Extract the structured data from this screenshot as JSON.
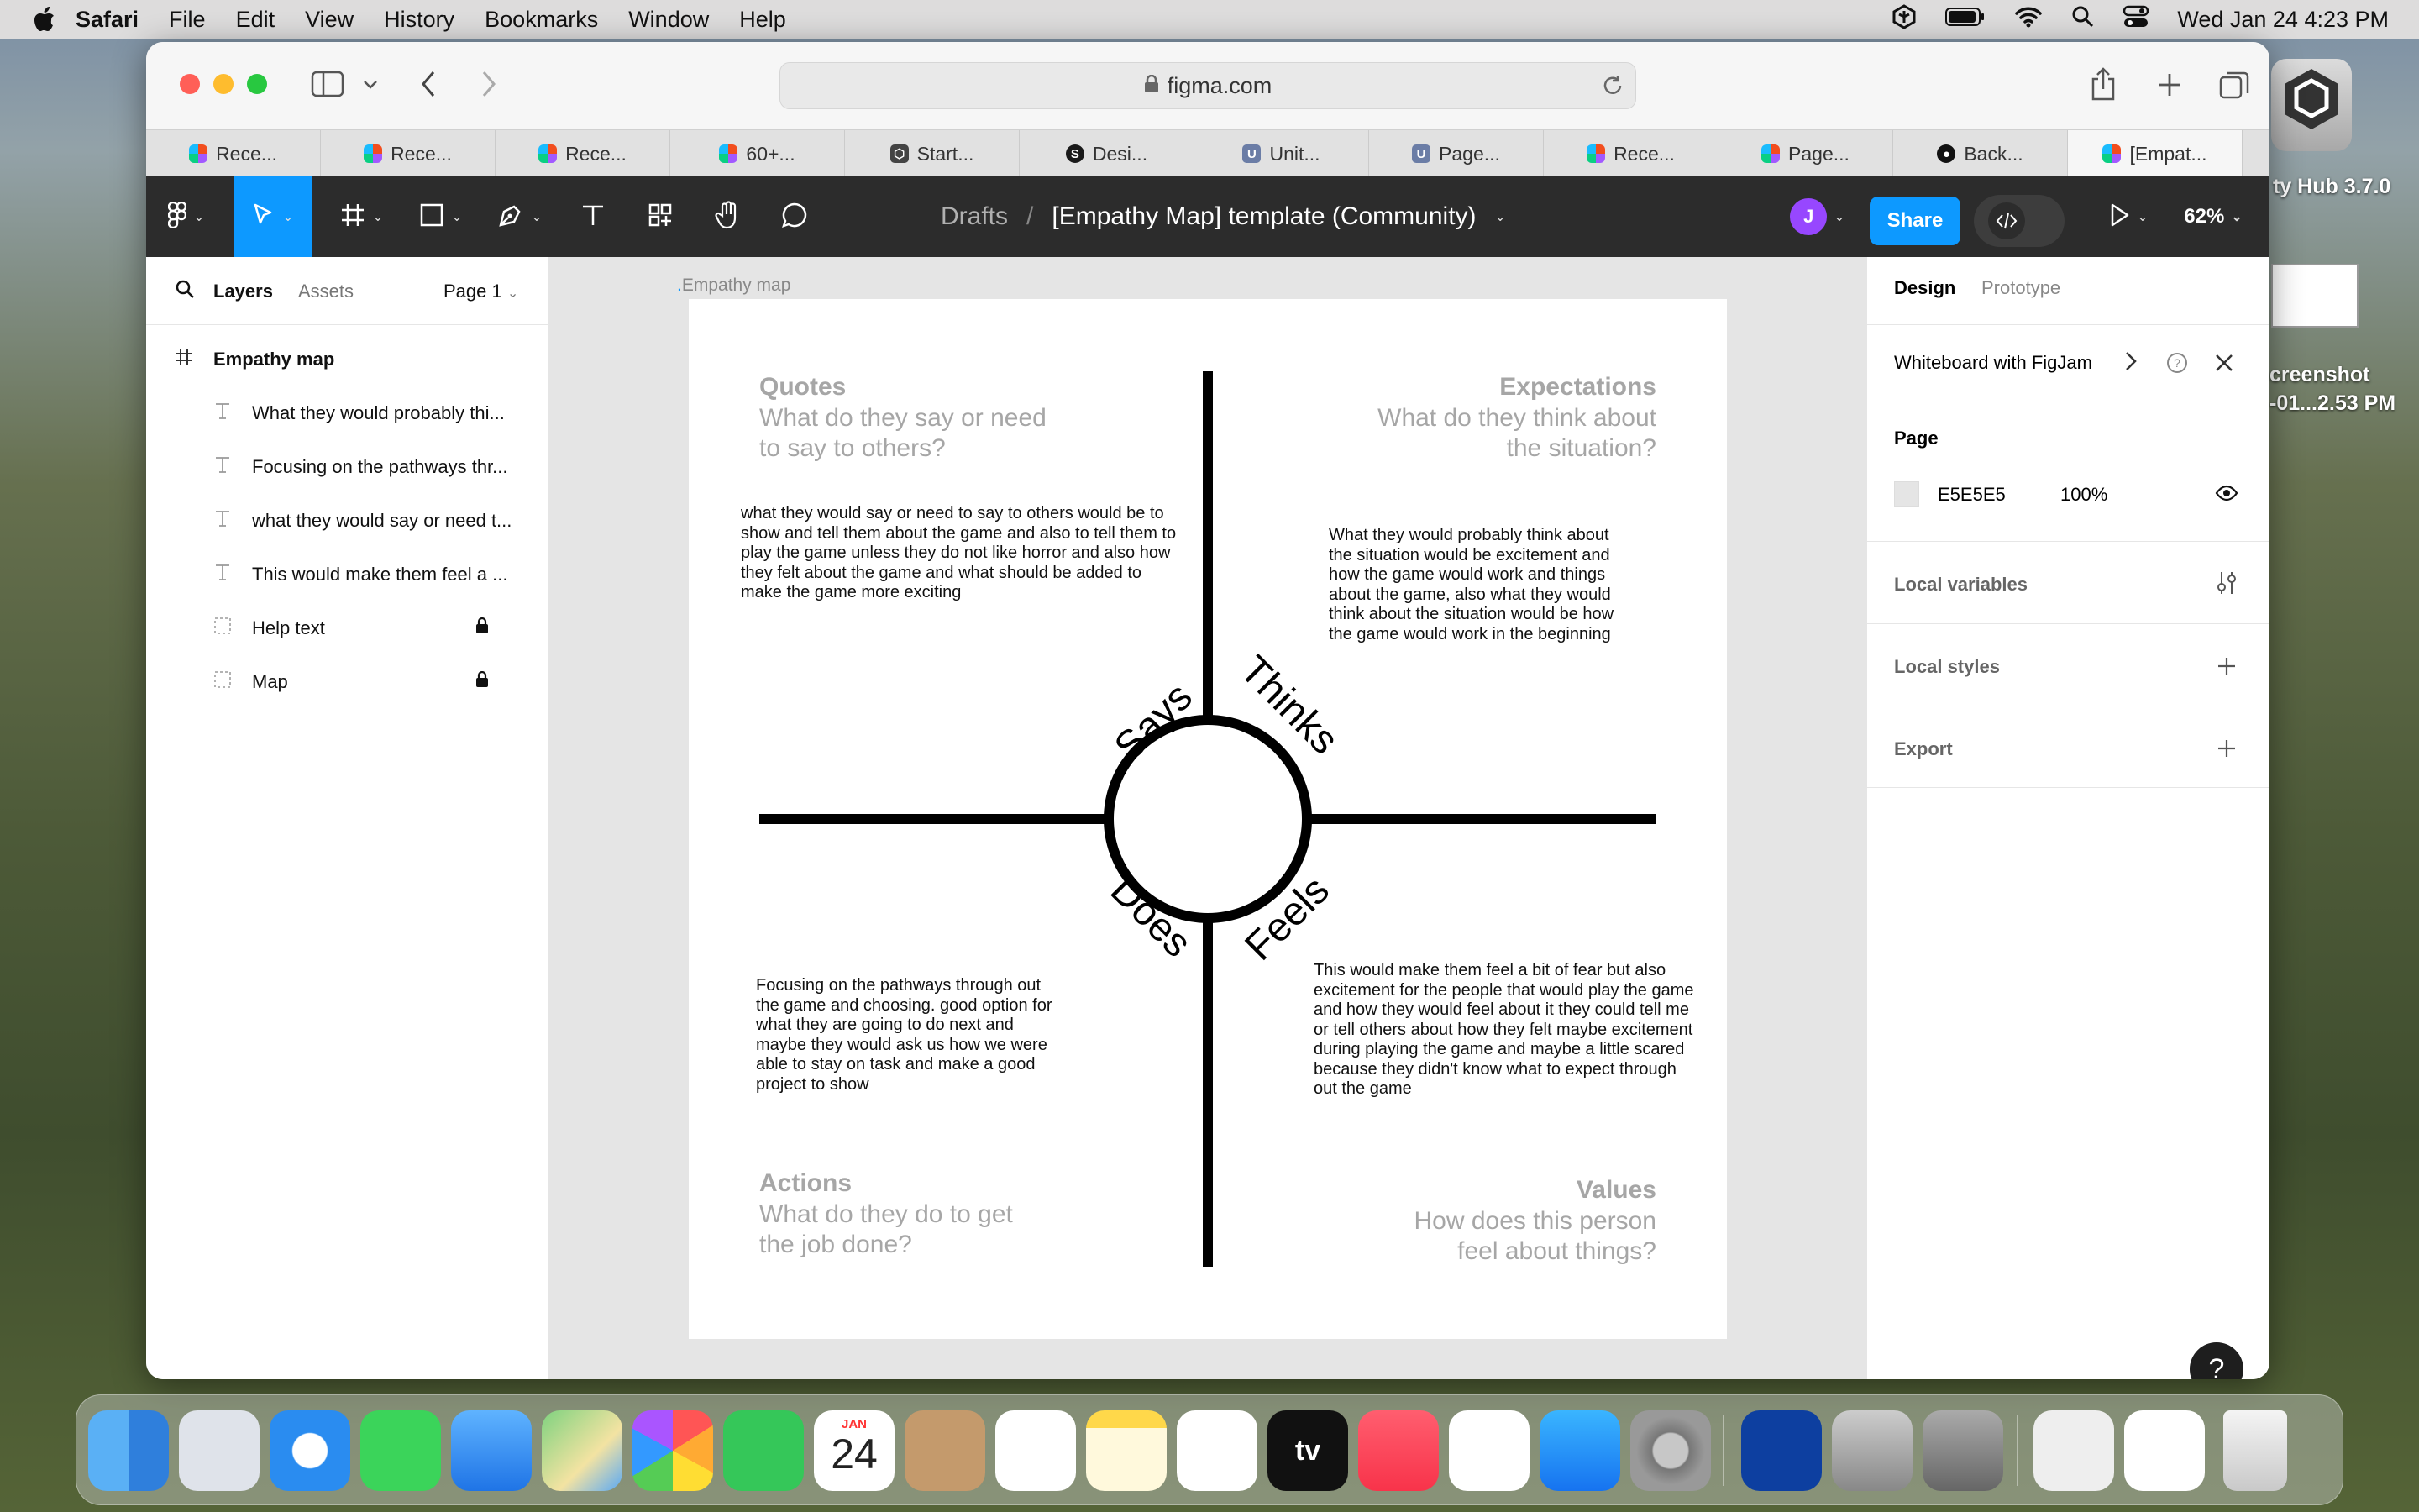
{
  "menubar": {
    "app": "Safari",
    "items": [
      "File",
      "Edit",
      "View",
      "History",
      "Bookmarks",
      "Window",
      "Help"
    ],
    "datetime": "Wed Jan 24  4:23 PM"
  },
  "browser": {
    "url": "figma.com",
    "tabs": [
      {
        "label": "Rece...",
        "icon": "figma-icon"
      },
      {
        "label": "Rece...",
        "icon": "figma-icon"
      },
      {
        "label": "Rece...",
        "icon": "figma-icon"
      },
      {
        "label": "60+...",
        "icon": "figma-icon"
      },
      {
        "label": "Start...",
        "icon": "unity-icon"
      },
      {
        "label": "Desi...",
        "icon": "s-icon"
      },
      {
        "label": "Unit...",
        "icon": "u-icon"
      },
      {
        "label": "Page...",
        "icon": "u-icon"
      },
      {
        "label": "Rece...",
        "icon": "figma-icon"
      },
      {
        "label": "Page...",
        "icon": "figma-icon"
      },
      {
        "label": "Back...",
        "icon": "github-icon"
      },
      {
        "label": "[Empat...",
        "icon": "figma-icon"
      }
    ]
  },
  "figma": {
    "breadcrumb_drafts": "Drafts",
    "file_title": "[Empathy Map] template (Community)",
    "avatar_letter": "J",
    "share_label": "Share",
    "zoom": "62%"
  },
  "left_panel": {
    "tab_layers": "Layers",
    "tab_assets": "Assets",
    "page_selector": "Page 1",
    "frame_name": "Empathy map",
    "layers": [
      "What they would probably thi...",
      "Focusing on the pathways thr...",
      "what they would say or need t...",
      "This would make them feel a ...",
      "Help text",
      "Map"
    ]
  },
  "canvas": {
    "frame_label": "Empathy map",
    "quotes_title": "Quotes",
    "quotes_sub": "What do they say or need to say to others?",
    "expectations_title": "Expectations",
    "expectations_sub": "What do they think about the situation?",
    "actions_title": "Actions",
    "actions_sub": "What do they do to get the job done?",
    "values_title": "Values",
    "values_sub": "How does this person feel about things?",
    "says": "Says",
    "thinks": "Thinks",
    "does": "Does",
    "feels": "Feels",
    "note_says": "what they would say or need to say to others would be to show and tell them about the game and also to tell them to play the game unless they do not like horror and also how they felt about the game and what should be added to make the game more exciting",
    "note_thinks": "What they would probably think about the situation would be excitement and how the game would work and things about the game, also what they would think about the situation would be how the game would work in the beginning",
    "note_does": "Focusing on the pathways through out the game and choosing. good option for what they are going to do next and maybe they would ask us how we were able to stay on task and make a good project to show",
    "note_feels": "This would make them feel a bit of fear but also excitement for the people that would play the game and how they would feel about it they could tell me or tell others about how they felt maybe excitement during playing the game and maybe a little scared because they didn't know what to expect through out the game"
  },
  "right_panel": {
    "tab_design": "Design",
    "tab_prototype": "Prototype",
    "banner": "Whiteboard with FigJam",
    "page_label": "Page",
    "page_color": "E5E5E5",
    "page_opacity": "100%",
    "local_variables": "Local variables",
    "local_styles": "Local styles",
    "export": "Export",
    "help": "?"
  },
  "desktop": {
    "label1": "ty Hub 3.7.0",
    "label2": "creenshot",
    "label3": "-01...2.53 PM",
    "calendar_month": "JAN",
    "calendar_day": "24"
  },
  "colors": {
    "figma_dark": "#2c2c2c",
    "accent_blue": "#0d99ff",
    "avatar_purple": "#9747ff"
  }
}
